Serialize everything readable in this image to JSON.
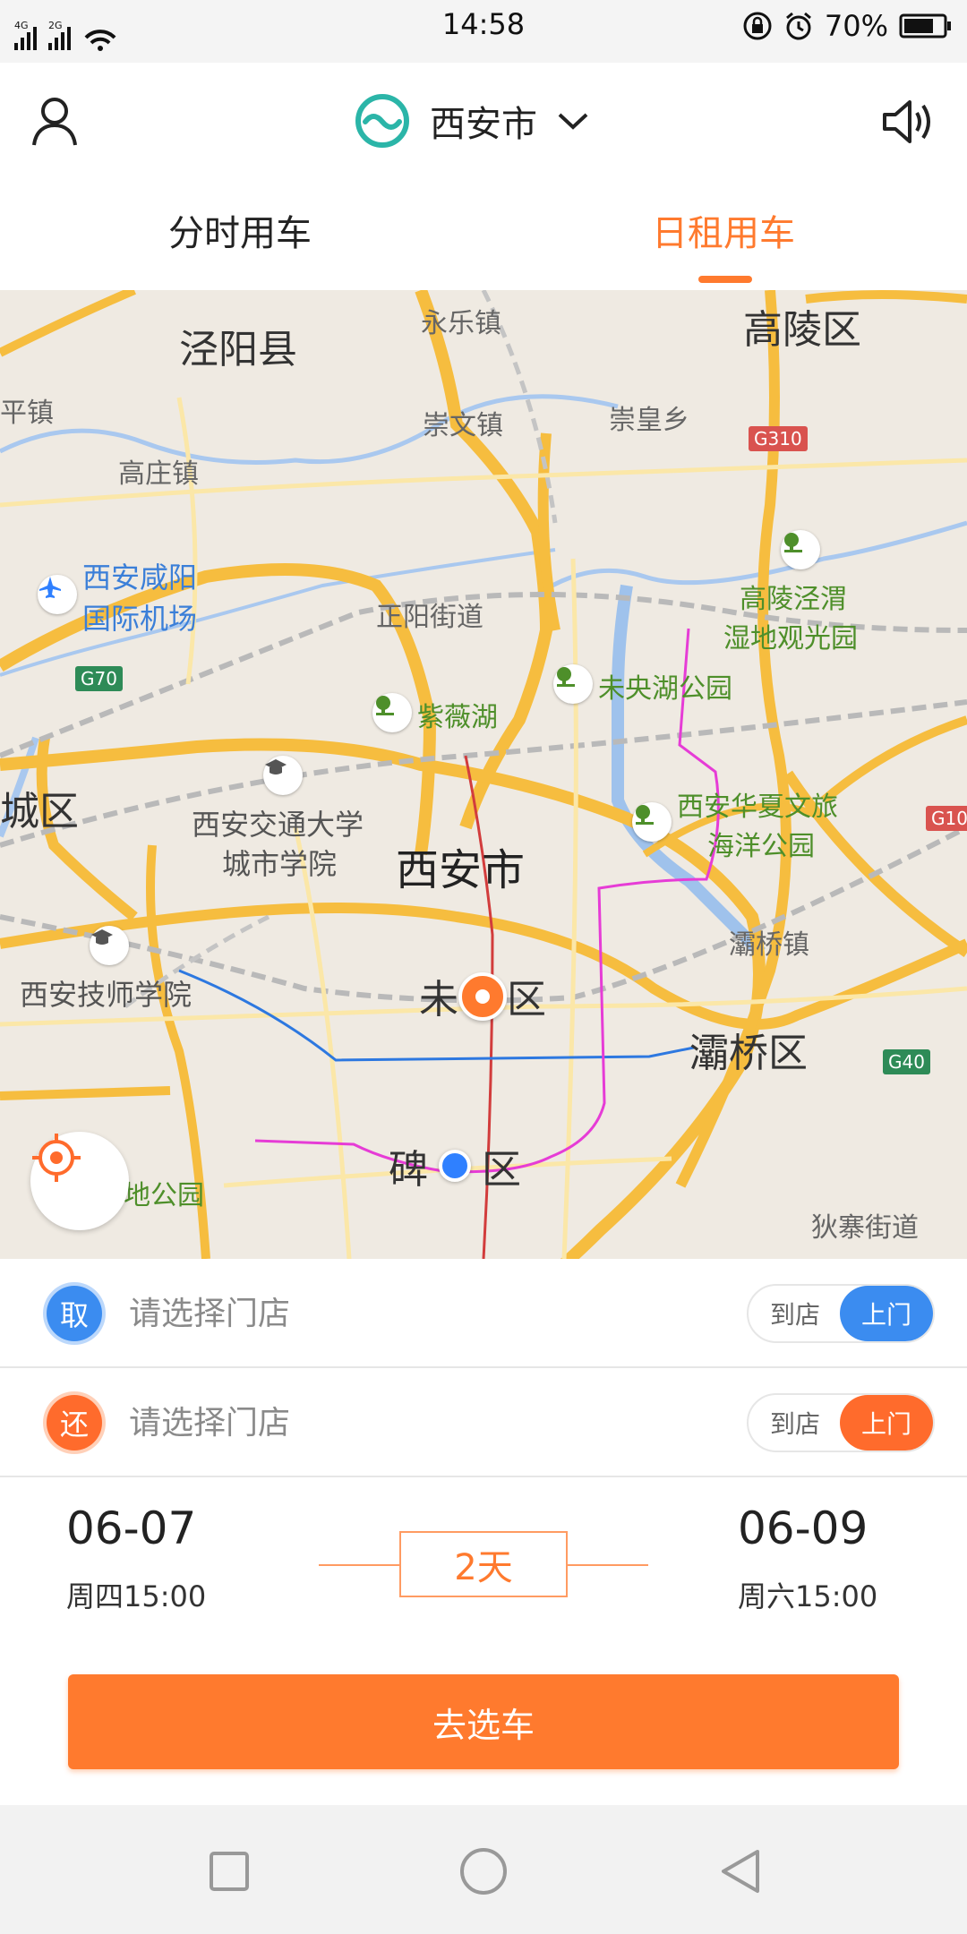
{
  "status_bar": {
    "time": "14:58",
    "battery": "70%",
    "net1": "4G",
    "net2": "2G"
  },
  "header": {
    "city": "西安市"
  },
  "tabs": [
    {
      "label": "分时用车",
      "active": false
    },
    {
      "label": "日租用车",
      "active": true
    }
  ],
  "map": {
    "labels": {
      "jingyang": "泾阳县",
      "yongle": "永乐镇",
      "gaoling": "高陵区",
      "ping": "平镇",
      "chongwen": "崇文镇",
      "chonghuang": "崇皇乡",
      "gaozhuang": "高庄镇",
      "airport_l1": "西安咸阳",
      "airport_l2": "国际机场",
      "zhengyang": "正阳街道",
      "gaoling_park_l1": "高陵泾渭",
      "gaoling_park_l2": "湿地观光园",
      "weiyang_park": "未央湖公园",
      "ziwei": "紫薇湖",
      "cheng": "城区",
      "xjtu_l1": "西安交通大学",
      "xjtu_l2": "城市学院",
      "xian_city": "西安市",
      "huaxia_l1": "西安华夏文旅",
      "huaxia_l2": "海洋公园",
      "baqiao_town": "灞桥镇",
      "jishi": "西安技师学院",
      "weiyang_dist_a": "未",
      "weiyang_dist_b": "区",
      "baqiao": "灞桥区",
      "beilin_a": "碑",
      "beilin_b": "区",
      "park_bottom": "地公园",
      "dizhai": "狄寨街道",
      "road_g310": "G310",
      "road_g70": "G70",
      "road_g10": "G10",
      "road_g40": "G40"
    }
  },
  "pickup": {
    "badge": "取",
    "placeholder": "请选择门店",
    "opt_store": "到店",
    "opt_door": "上门"
  },
  "return": {
    "badge": "还",
    "placeholder": "请选择门店",
    "opt_store": "到店",
    "opt_door": "上门"
  },
  "dates": {
    "start_date": "06-07",
    "start_time": "周四15:00",
    "duration": "2天",
    "end_date": "06-09",
    "end_time": "周六15:00"
  },
  "cta": "去选车",
  "colors": {
    "accent": "#ff7a2e",
    "blue": "#3b8cf0",
    "brand_teal": "#2bb5a8"
  }
}
